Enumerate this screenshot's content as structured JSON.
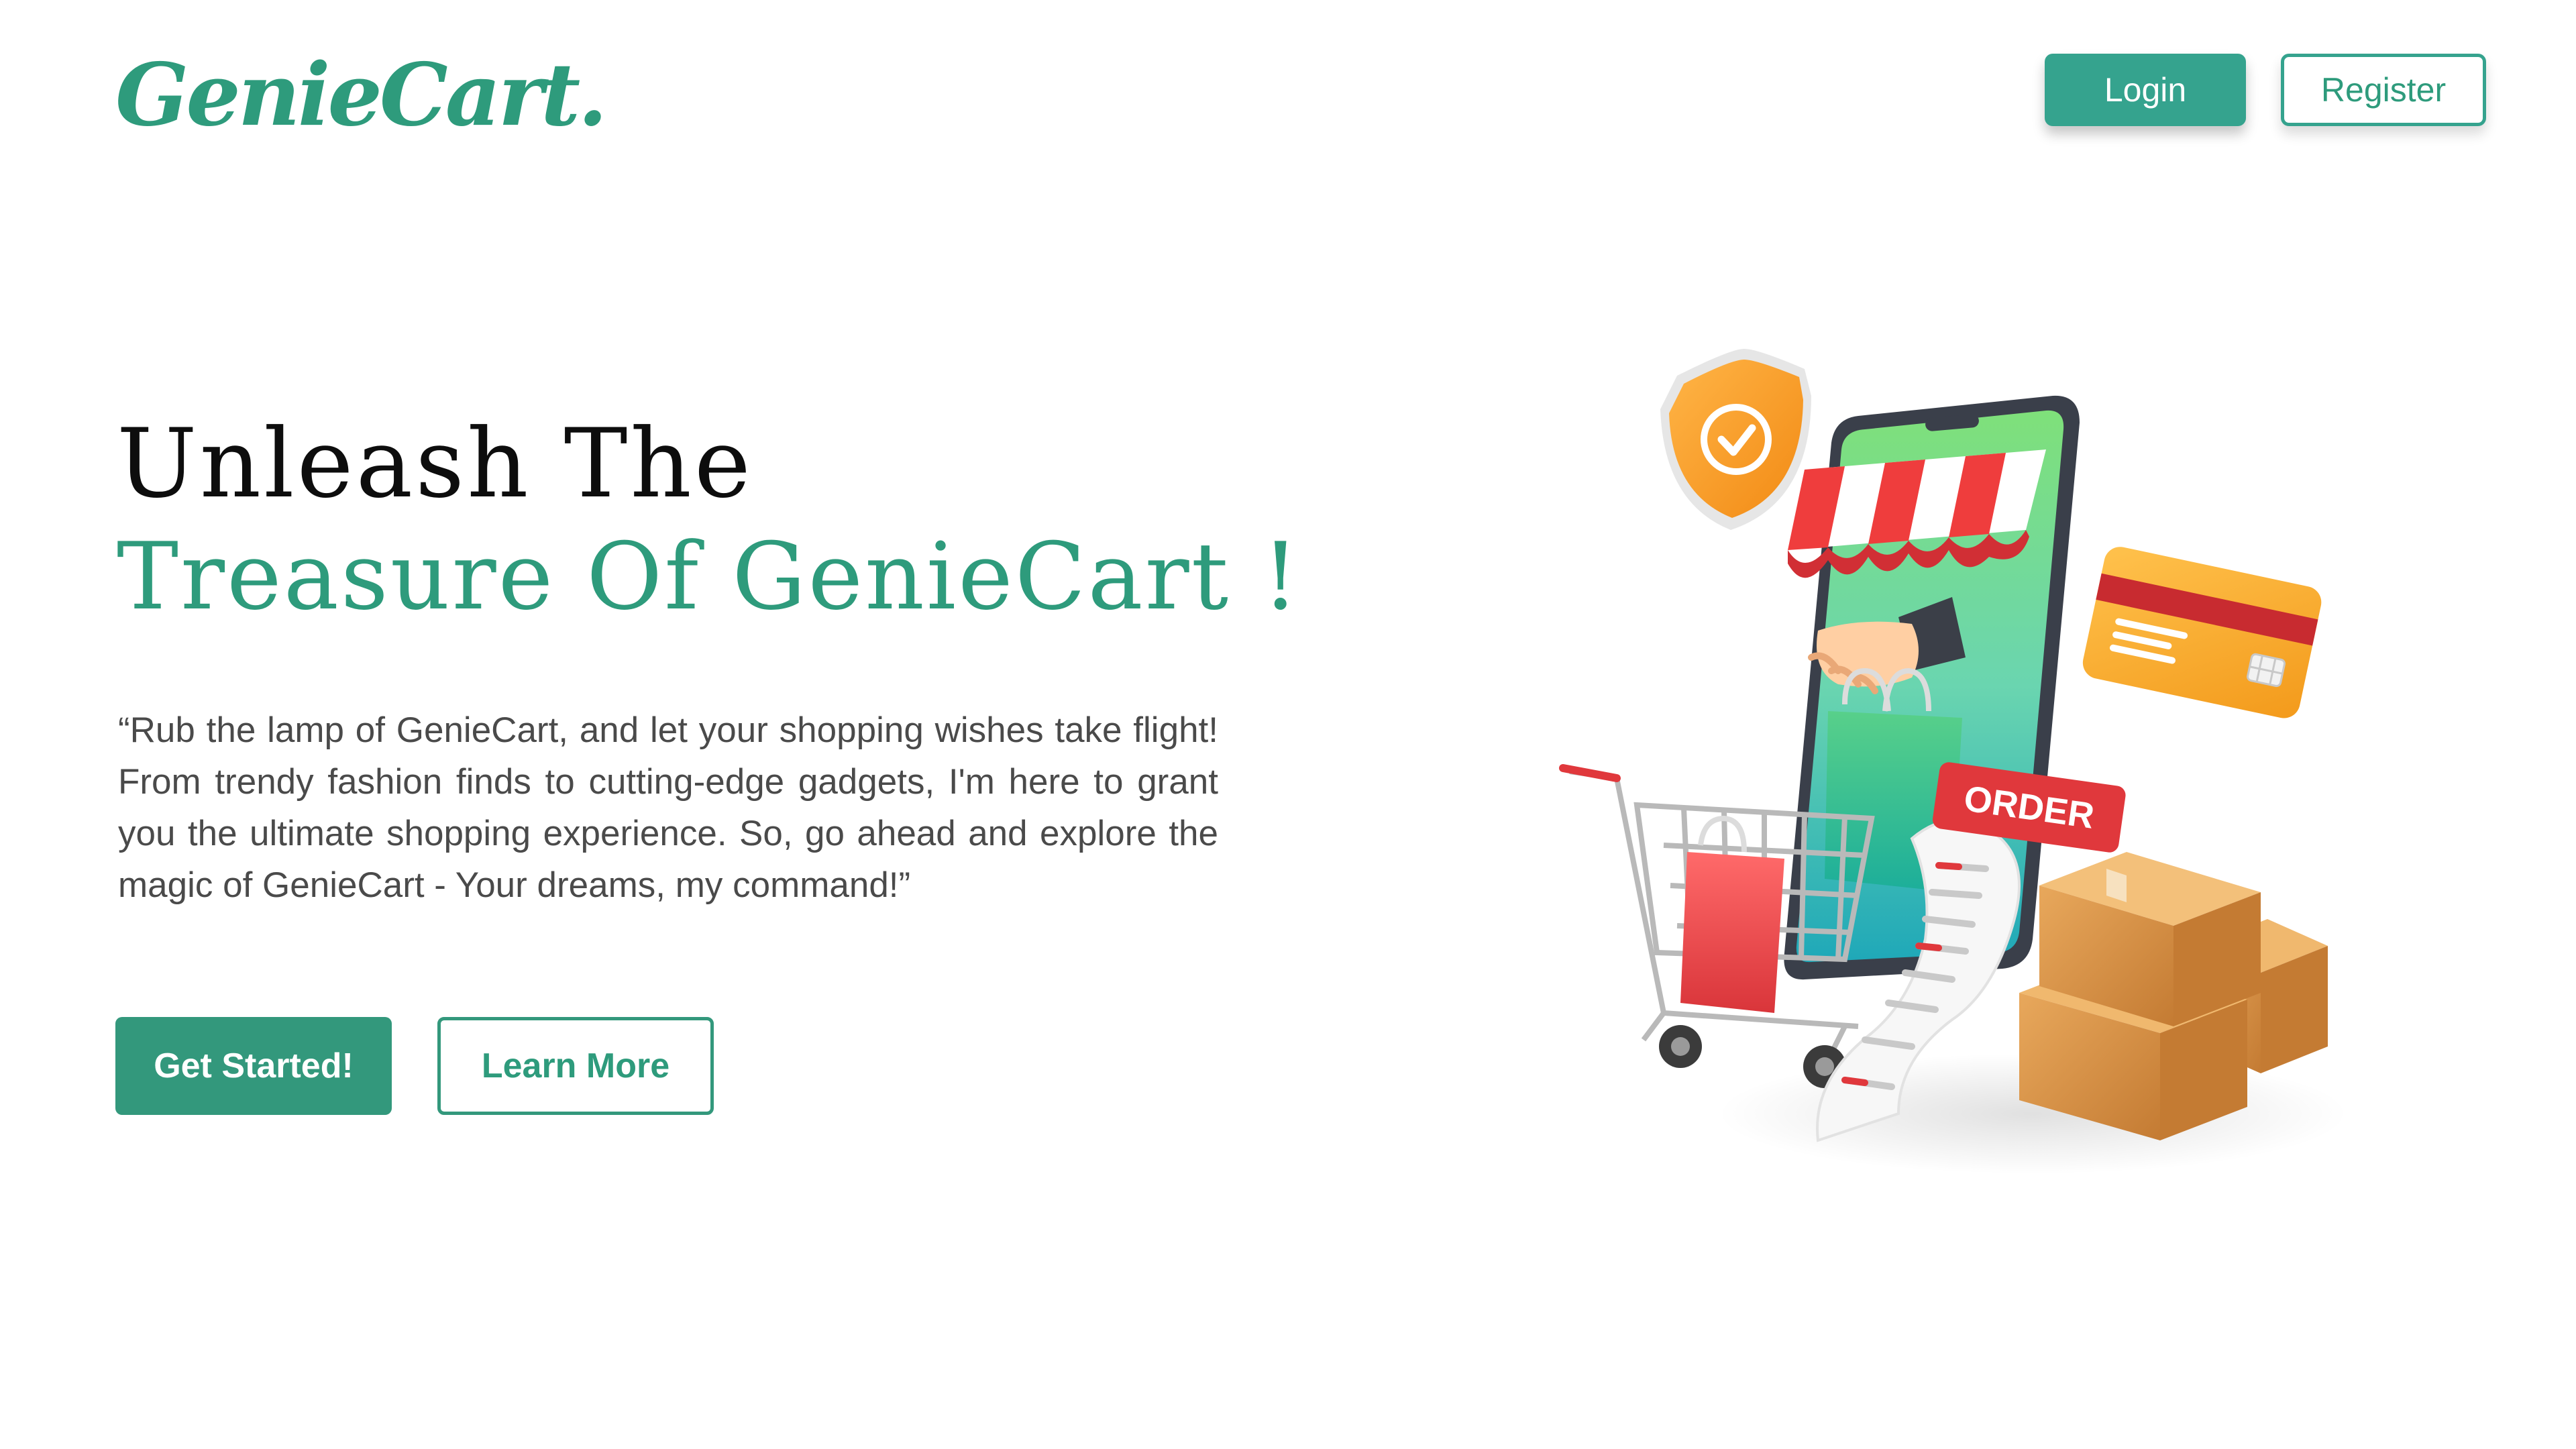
{
  "header": {
    "logo_text": "GenieCart.",
    "login_label": "Login",
    "register_label": "Register"
  },
  "hero": {
    "headline_line1": "Unleash The",
    "headline_line2": "Treasure Of GenieCart !",
    "tagline": "“Rub the lamp of GenieCart, and let your shopping wishes take flight! From trendy fashion finds to cutting-edge gadgets, I'm here to grant you the ultimate shopping experience. So, go ahead and explore the magic of GenieCart - Your dreams, my command!”",
    "get_started_label": "Get Started!",
    "learn_more_label": "Learn More"
  },
  "illustration": {
    "order_label": "ORDER",
    "icons": [
      "shield-check-icon",
      "smartphone-store",
      "credit-card",
      "shopping-cart",
      "shopping-bag",
      "receipt",
      "cardboard-box",
      "hand"
    ]
  },
  "colors": {
    "brand": "#2e9b7c",
    "button": "#35a38e",
    "headline": "#0d0d0d",
    "body_text": "#4a4a4a"
  }
}
